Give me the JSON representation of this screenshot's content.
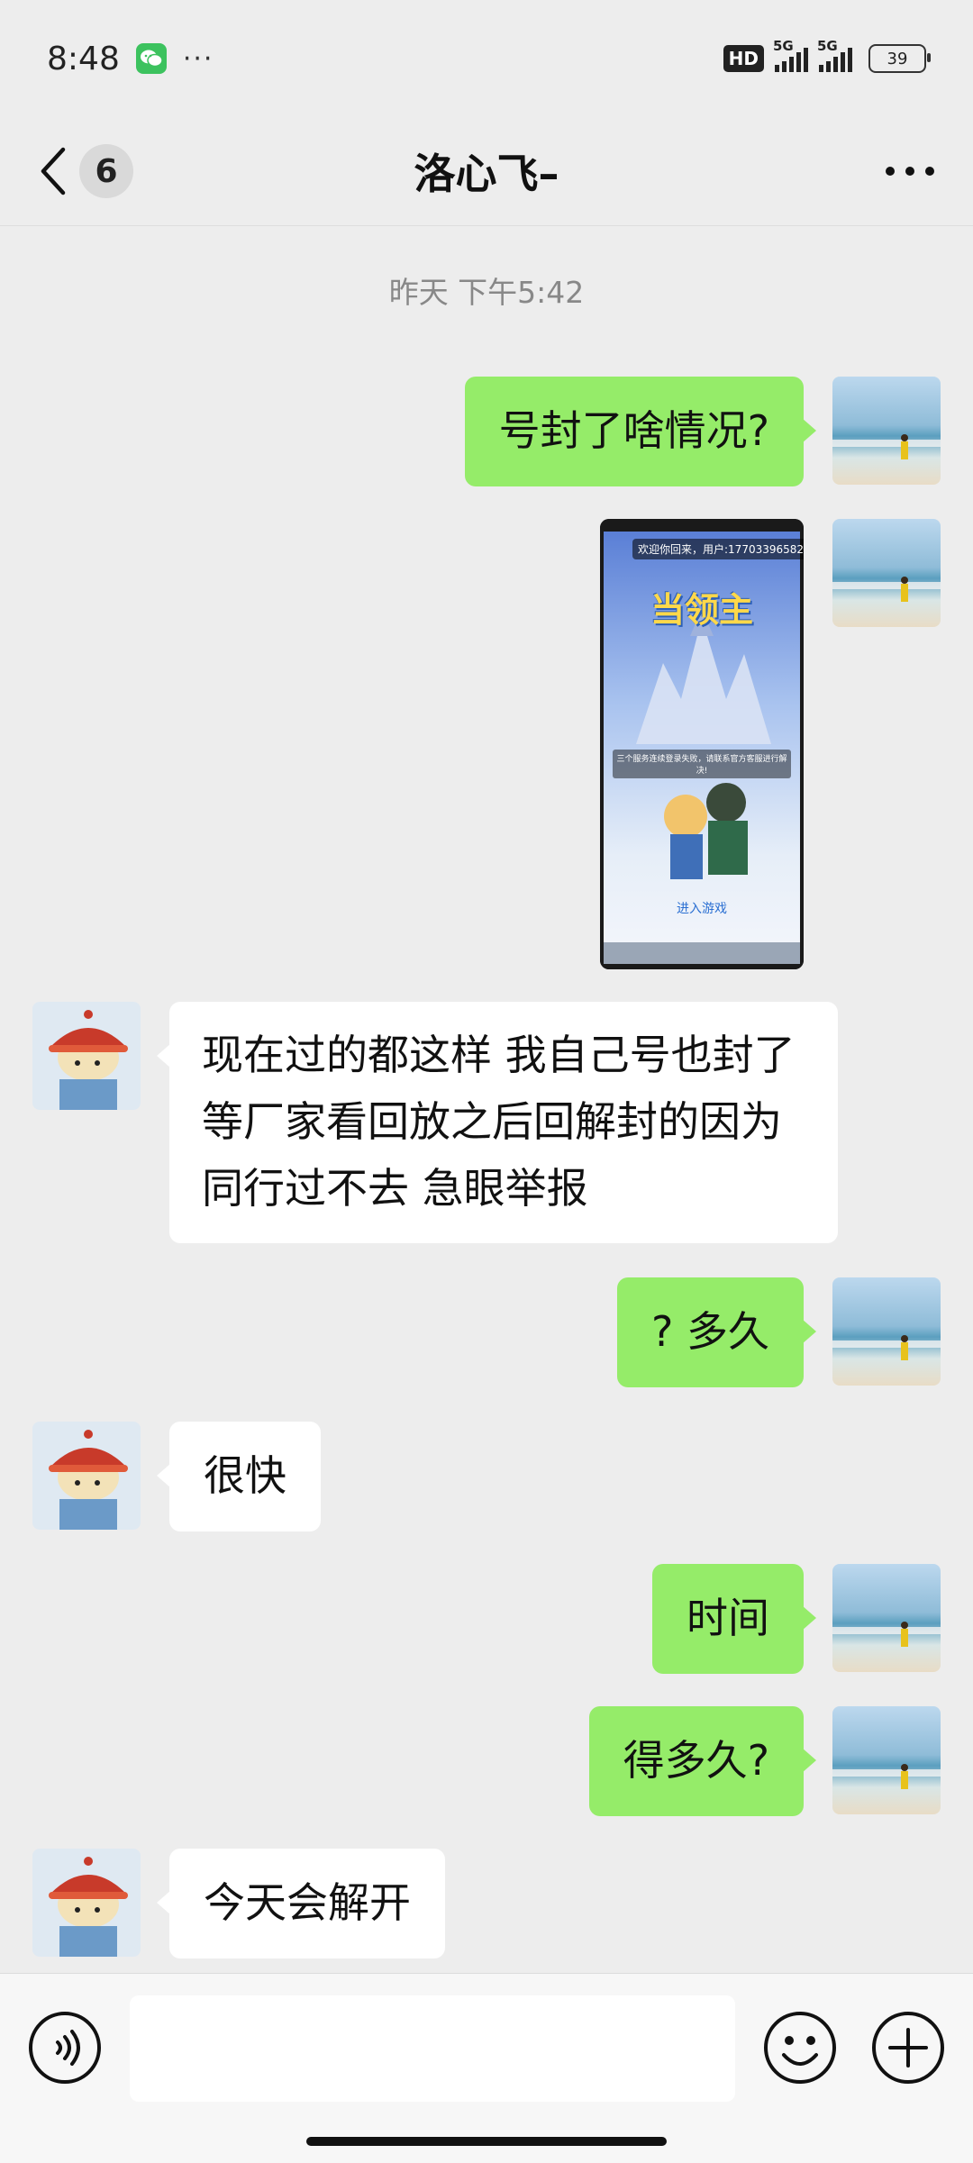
{
  "status": {
    "time": "8:48",
    "dots": "···",
    "hd": "HD",
    "network1": "5G",
    "network2": "5G",
    "battery": "39"
  },
  "header": {
    "unread": "6",
    "title": "洛心飞–"
  },
  "chat": {
    "timestamp": "昨天 下午5:42",
    "messages": [
      {
        "text": "号封了啥情况?"
      },
      {
        "image": {
          "welcome": "欢迎你回来，用户:17703396582",
          "logo": "当领主",
          "notice": "三个服务连续登录失败，请联系官方客服进行解决!",
          "enter": "进入游戏"
        }
      },
      {
        "text": "现在过的都这样 我自己号也封了 等厂家看回放之后回解封的因为同行过不去 急眼举报"
      },
      {
        "text": "? 多久"
      },
      {
        "text": "很快"
      },
      {
        "text": "时间"
      },
      {
        "text": "得多久?"
      },
      {
        "text": "今天会解开"
      }
    ]
  },
  "input": {
    "placeholder": ""
  },
  "colors": {
    "self_bubble": "#95ec69",
    "other_bubble": "#ffffff",
    "background": "#ededed"
  }
}
